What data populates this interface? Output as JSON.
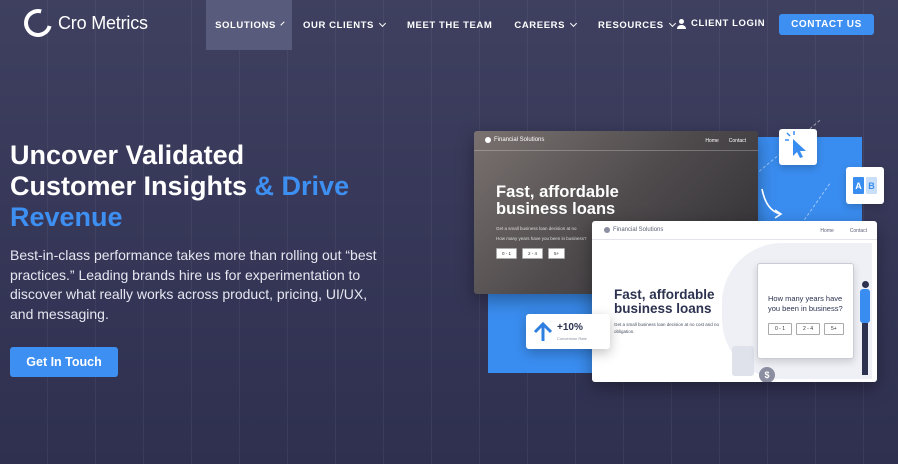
{
  "brand": {
    "name": "Cro Metrics"
  },
  "nav": {
    "items": [
      {
        "label": "SOLUTIONS",
        "has_dropdown": true,
        "active": true
      },
      {
        "label": "OUR CLIENTS",
        "has_dropdown": true,
        "active": false
      },
      {
        "label": "MEET THE TEAM",
        "has_dropdown": false,
        "active": false
      },
      {
        "label": "CAREERS",
        "has_dropdown": true,
        "active": false
      },
      {
        "label": "RESOURCES",
        "has_dropdown": true,
        "active": false
      }
    ],
    "login_label": "CLIENT LOGIN",
    "contact_label": "CONTACT US"
  },
  "hero": {
    "title_line1": "Uncover Validated",
    "title_line2": "Customer Insights",
    "title_accent_part1": "& Drive",
    "title_accent_part2": "Revenue",
    "subtitle": "Best-in-class performance takes more than rolling out “best practices.” Leading brands hire us for experimentation to discover what really works across product, pricing, UI/UX, and messaging.",
    "cta_label": "Get In Touch"
  },
  "illustration": {
    "back_card": {
      "brand": "Financial Solutions",
      "links": [
        "Home",
        "Contact"
      ],
      "headline": "Fast, affordable business loans",
      "text_line1": "Get a small business loan decision at no",
      "text_line2": "How many years have you been in business?",
      "options": [
        "0 - 1",
        "2 - 4",
        "5+"
      ]
    },
    "front_card": {
      "brand": "Financial Solutions",
      "links": [
        "Home",
        "Contact"
      ],
      "headline": "Fast, affordable business loans",
      "text": "Get a small business loan decision at no cost and no obligation.",
      "question": "How many years have you been in business?",
      "options": [
        "0 - 1",
        "2 - 4",
        "5+"
      ],
      "coin_symbol": "$"
    },
    "stat": {
      "value": "+10%",
      "label": "Conversion Rate"
    },
    "ab": {
      "a": "A",
      "b": "B"
    },
    "colors": {
      "accent": "#3d8ff2",
      "navy": "#2c3250"
    }
  }
}
